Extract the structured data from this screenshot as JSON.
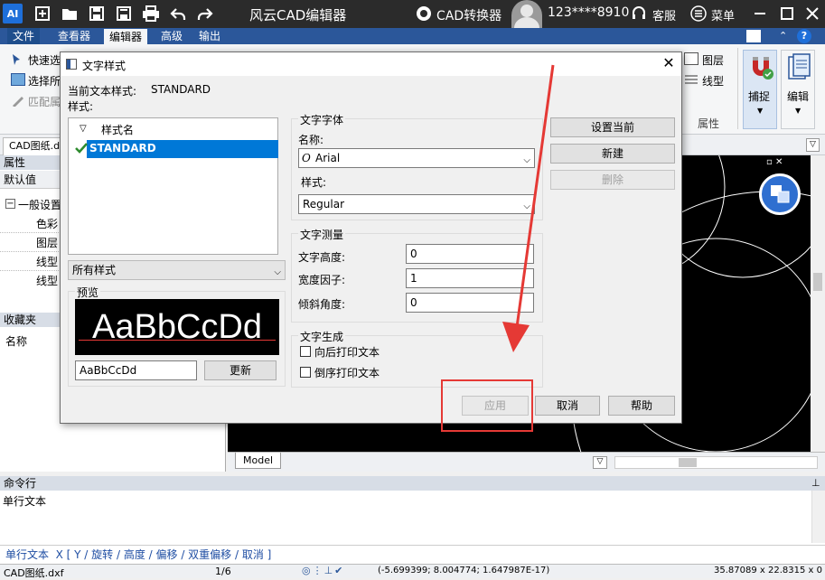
{
  "titlebar": {
    "app_title": "风云CAD编辑器",
    "converter": "CAD转换器",
    "account": "123****8910",
    "service": "客服",
    "menu": "菜单"
  },
  "menubar": {
    "tabs": [
      "文件",
      "查看器",
      "编辑器",
      "高级",
      "输出"
    ]
  },
  "ribbon": {
    "quick_select": "快速选",
    "select_all": "选择所",
    "match_props": "匹配属",
    "layer": "图层",
    "linetype": "线型",
    "properties": "属性",
    "snap": "捕捉",
    "edit": "编辑"
  },
  "leftpanel": {
    "doc_tab": "CAD图纸.dxf",
    "props_header": "属性",
    "default_value": "默认值",
    "general": "一般设置",
    "color": "色彩",
    "layer": "图层",
    "linetype1": "线型",
    "linetype2": "线型",
    "favorites_header": "收藏夹",
    "name": "名称"
  },
  "canvas": {
    "model_tab": "Model"
  },
  "command": {
    "header": "命令行",
    "text": "单行文本",
    "prompt": "单行文本  X [ Y / 旋转 / 高度 / 偏移 / 双重偏移 / 取消 ]"
  },
  "status": {
    "file": "CAD图纸.dxf",
    "pages": "1/6",
    "coords": "(-5.699399; 8.004774; 1.647987E-17)",
    "size": "35.87089 x 22.8315 x 0"
  },
  "dialog": {
    "title": "文字样式",
    "current_style_label": "当前文本样式:",
    "current_style": "STANDARD",
    "styles_label": "样式:",
    "list_header": "样式名",
    "styles": [
      "STANDARD"
    ],
    "filter": "所有样式",
    "preview_label": "预览",
    "preview_text": "AaBbCcDd",
    "preview_input": "AaBbCcDd",
    "update_btn": "更新",
    "font_group": "文字字体",
    "font_name_label": "名称:",
    "font_name": "Arial",
    "font_style_label": "样式:",
    "font_style": "Regular",
    "measure_group": "文字测量",
    "height_label": "文字高度:",
    "height": "0",
    "width_label": "宽度因子:",
    "width": "1",
    "oblique_label": "倾斜角度:",
    "oblique": "0",
    "gen_group": "文字生成",
    "backward": "向后打印文本",
    "upside": "倒序打印文本",
    "set_current": "设置当前",
    "new": "新建",
    "delete": "删除",
    "apply": "应用",
    "cancel": "取消",
    "help": "帮助"
  },
  "colors": {
    "accent": "#2b579a",
    "highlight": "#e53935",
    "selection": "#0078d7"
  }
}
